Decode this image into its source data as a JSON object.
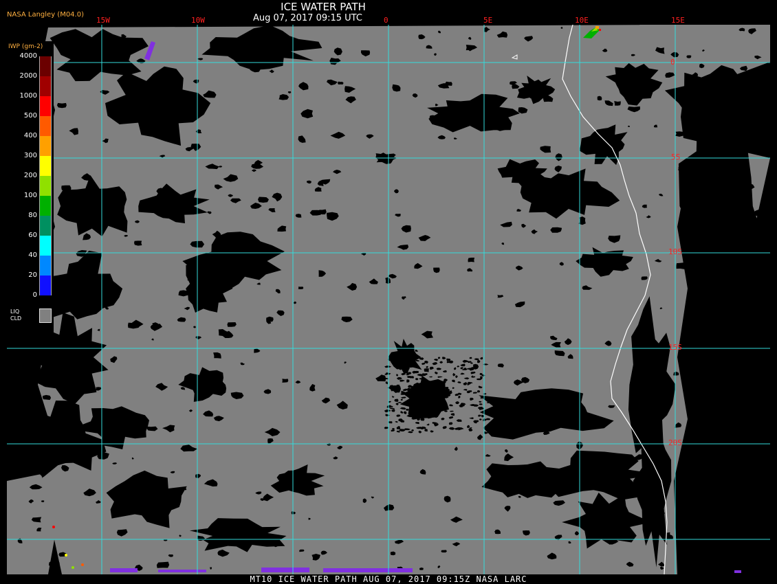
{
  "header": {
    "title": "ICE WATER PATH",
    "subtitle": "Aug 07, 2017 09:15 UTC",
    "producer": "NASA Langley (M04.0)"
  },
  "footer": {
    "text": "MT10  ICE WATER PATH  AUG 07, 2017 09:15Z  NASA LARC"
  },
  "legend": {
    "unit": "IWP (gm-2)",
    "levels": [
      {
        "label": "4000",
        "color": "#6b0000"
      },
      {
        "label": "2000",
        "color": "#a00000"
      },
      {
        "label": "1000",
        "color": "#ff0000"
      },
      {
        "label": "500",
        "color": "#ff5a00"
      },
      {
        "label": "400",
        "color": "#ffa000"
      },
      {
        "label": "300",
        "color": "#ffff00"
      },
      {
        "label": "200",
        "color": "#90e000"
      },
      {
        "label": "100",
        "color": "#00b000"
      },
      {
        "label": "80",
        "color": "#009060"
      },
      {
        "label": "60",
        "color": "#00ffff"
      },
      {
        "label": "40",
        "color": "#0088ff"
      },
      {
        "label": "20",
        "color": "#1010ff"
      },
      {
        "label": "0",
        "color": "#8030e0"
      }
    ],
    "liquid_cloud_label": "LIQ\nCLD",
    "liquid_cloud_color": "#808080"
  },
  "map": {
    "longitude_labels": [
      "15W",
      "10W",
      "0",
      "5E",
      "10E",
      "15E"
    ],
    "latitude_labels": [
      "0",
      "5S",
      "10S",
      "15S",
      "20S"
    ],
    "colors": {
      "grid": "#33dddd",
      "liquid_cloud": "#808080",
      "clear": "#000000",
      "coast": "#ffffff",
      "label": "#ff2020"
    }
  }
}
